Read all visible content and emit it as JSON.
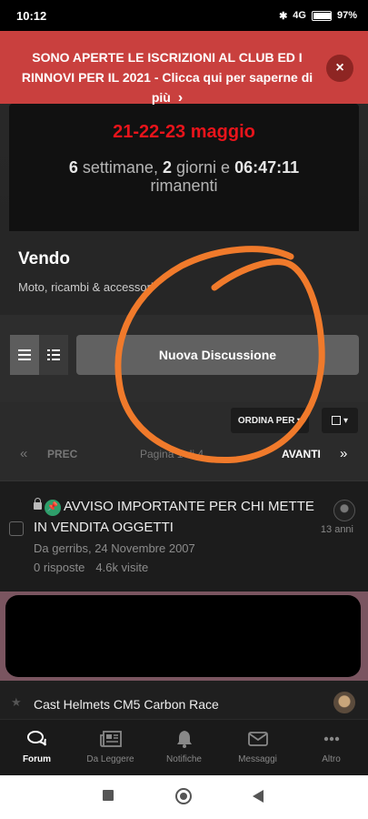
{
  "status_bar": {
    "time": "10:12",
    "battery": "97%",
    "battery_level": 0.97,
    "network": "4G"
  },
  "notice": {
    "text": "SONO APERTE LE ISCRIZIONI AL CLUB ED I RINNOVI PER IL 2021 - Clicca qui per saperne di più",
    "arrow": "›",
    "close": "×"
  },
  "countdown": {
    "dates": "21-22-23 maggio",
    "weeks_value": "6",
    "weeks_label": "settimane,",
    "days_value": "2",
    "days_label": "giorni e",
    "time_value": "06:47:11",
    "remaining_label": "rimanenti"
  },
  "section": {
    "title": "Vendo",
    "description": "Moto, ricambi & accessori"
  },
  "toolbar": {
    "new_discussion": "Nuova Discussione"
  },
  "sort": {
    "sort_label": "ORDINA PER ▾",
    "filter_caret": "▾"
  },
  "pager": {
    "first": "«",
    "prev": "PREC",
    "info": "Pagina 1 di 4",
    "next": "AVANTI",
    "last": "»"
  },
  "threads": [
    {
      "title": "AVVISO IMPORTANTE PER CHI METTE IN VENDITA OGGETTI",
      "meta": "Da gerribs, 24 Novembre 2007",
      "replies": "0 risposte",
      "views": "4.6k visite",
      "age": "13 anni",
      "pinned": true,
      "locked": true
    },
    {
      "title": "Cast Helmets CM5 Carbon Race"
    }
  ],
  "bottom_nav": [
    {
      "label": "Forum",
      "icon": "chat-bubbles-icon",
      "active": true
    },
    {
      "label": "Da Leggere",
      "icon": "newspaper-icon"
    },
    {
      "label": "Notifiche",
      "icon": "bell-icon"
    },
    {
      "label": "Messaggi",
      "icon": "envelope-icon"
    },
    {
      "label": "Altro",
      "icon": "more-dots-icon"
    }
  ],
  "colors": {
    "notice_bg": "#c9403e",
    "dates_red": "#e8141b",
    "annotation_orange": "#f07a2b",
    "pin_green": "#2e9e6a"
  }
}
